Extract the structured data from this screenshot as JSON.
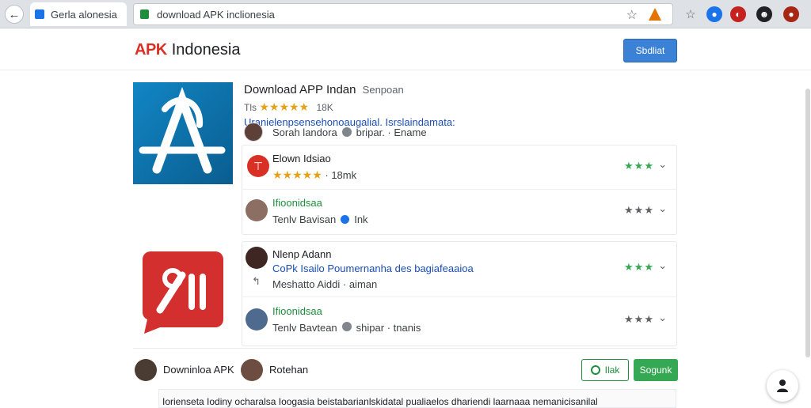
{
  "browser": {
    "tab_title": "Gerla alonesia",
    "url": "download APK inclionesia",
    "bookmark_icon": "star-icon",
    "extension_icon": "warning-triangle-icon"
  },
  "header": {
    "logo_apk": "APK",
    "logo_text": "Indonesia",
    "button_label": "Sbdliat"
  },
  "app1": {
    "title": "Download APP Indan",
    "title_muted": "Senpoan",
    "rating_label": "Tls",
    "stars": "★★★★★",
    "rating_count": "18K",
    "description": "Uranielenpsensehonoaugalial. Isrslaindamata:",
    "developer": "Sorah landora",
    "meta": "bripar. · Ename"
  },
  "rows": [
    {
      "title": "Elown Idsiao",
      "stars": "★★★★★",
      "sub": "· 18mk",
      "rating": "★★★",
      "style": "plain"
    },
    {
      "title": "Ifioonidsaa",
      "sub_a": "Tenlv Bavisan",
      "sub_b": "Ink",
      "rating": "★★★",
      "style": "green"
    },
    {
      "title": "Nlenp Adann",
      "title2": "CoPk  Isailo  Poumernanha  des bagiafeaaioa",
      "sub": "Meshatto Aiddi · aiman",
      "rating": "★★★",
      "style": "blue"
    },
    {
      "title": "Ifioonidsaa",
      "sub_a": "Tenlv Bavtean",
      "sub_b": "shipar · tnanis",
      "rating": "★★★",
      "style": "green"
    }
  ],
  "bottom": {
    "left_label": "Downinloa APK",
    "right_label": "Rotehan",
    "btn_outline": "Ilak",
    "btn_green": "Sogunk",
    "text_line": "Iorienseta Iodiny ocharalsa Ioogasia beistabarianlskidatal pualiaelos dhariendi laarnaaa nemanicisanilal"
  },
  "colors": {
    "accent_blue": "#3b82d6",
    "accent_green": "#34a853",
    "star": "#e6a117"
  }
}
